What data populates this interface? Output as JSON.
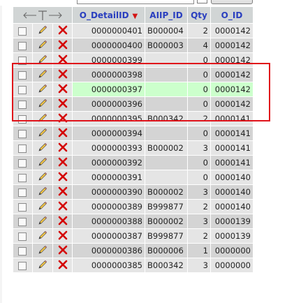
{
  "columns": {
    "detail_id": "O_DetailID",
    "aiip_id": "AIIP_ID",
    "qty": "Qty",
    "o_id": "O_ID",
    "sort_indicator": "▼"
  },
  "header_actions_icons": [
    "arrow-left-icon",
    "column-t-icon",
    "arrow-right-icon"
  ],
  "row_icons": {
    "edit": "pencil-icon",
    "delete": "delete-x-icon"
  },
  "colors": {
    "header_bg": "#d1d5d5",
    "header_text": "#2a3fbf",
    "row_odd": "#e5e5e5",
    "row_even": "#d4d4d4",
    "highlight": "#ccffcc",
    "selection_border": "#e0121a",
    "delete_red": "#d40000"
  },
  "rows": [
    {
      "detail_id": "0000000401",
      "aiip_id": "B000004",
      "qty": "2",
      "o_id": "0000142",
      "highlight": false
    },
    {
      "detail_id": "0000000400",
      "aiip_id": "B000003",
      "qty": "4",
      "o_id": "0000142",
      "highlight": false
    },
    {
      "detail_id": "0000000399",
      "aiip_id": "",
      "qty": "0",
      "o_id": "0000142",
      "highlight": false
    },
    {
      "detail_id": "0000000398",
      "aiip_id": "",
      "qty": "0",
      "o_id": "0000142",
      "highlight": false
    },
    {
      "detail_id": "0000000397",
      "aiip_id": "",
      "qty": "0",
      "o_id": "0000142",
      "highlight": true
    },
    {
      "detail_id": "0000000396",
      "aiip_id": "",
      "qty": "0",
      "o_id": "0000142",
      "highlight": false
    },
    {
      "detail_id": "0000000395",
      "aiip_id": "B000342",
      "qty": "2",
      "o_id": "0000141",
      "highlight": false
    },
    {
      "detail_id": "0000000394",
      "aiip_id": "",
      "qty": "0",
      "o_id": "0000141",
      "highlight": false
    },
    {
      "detail_id": "0000000393",
      "aiip_id": "B000002",
      "qty": "3",
      "o_id": "0000141",
      "highlight": false
    },
    {
      "detail_id": "0000000392",
      "aiip_id": "",
      "qty": "0",
      "o_id": "0000141",
      "highlight": false
    },
    {
      "detail_id": "0000000391",
      "aiip_id": "",
      "qty": "0",
      "o_id": "0000140",
      "highlight": false
    },
    {
      "detail_id": "0000000390",
      "aiip_id": "B000002",
      "qty": "3",
      "o_id": "0000140",
      "highlight": false
    },
    {
      "detail_id": "0000000389",
      "aiip_id": "B999877",
      "qty": "2",
      "o_id": "0000140",
      "highlight": false
    },
    {
      "detail_id": "0000000388",
      "aiip_id": "B000002",
      "qty": "3",
      "o_id": "0000139",
      "highlight": false
    },
    {
      "detail_id": "0000000387",
      "aiip_id": "B999877",
      "qty": "2",
      "o_id": "0000139",
      "highlight": false
    },
    {
      "detail_id": "0000000386",
      "aiip_id": "B000006",
      "qty": "1",
      "o_id": "0000000",
      "highlight": false
    },
    {
      "detail_id": "0000000385",
      "aiip_id": "B000342",
      "qty": "3",
      "o_id": "0000000",
      "highlight": false
    }
  ]
}
